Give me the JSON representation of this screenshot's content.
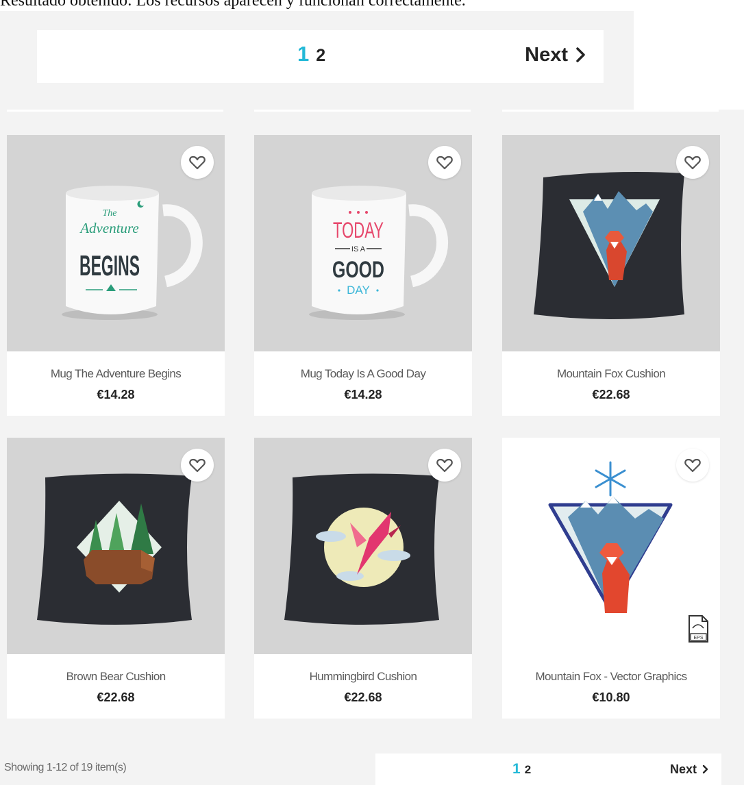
{
  "caption": "Resultado obtenido: Los recursos aparecen y funcionan correctamente.",
  "pagination": {
    "current_page": "1",
    "other_page": "2",
    "next_label": "Next"
  },
  "products": [
    {
      "name": "Mug The Adventure Begins",
      "price": "€14.28",
      "art": {
        "line1": "The",
        "line2": "Adventure",
        "line3": "BEGINS"
      }
    },
    {
      "name": "Mug Today Is A Good Day",
      "price": "€14.28",
      "art": {
        "line1": "TODAY",
        "line2": "IS A",
        "line3": "GOOD",
        "line4": "DAY"
      }
    },
    {
      "name": "Mountain Fox Cushion",
      "price": "€22.68"
    },
    {
      "name": "Brown Bear Cushion",
      "price": "€22.68"
    },
    {
      "name": "Hummingbird Cushion",
      "price": "€22.68"
    },
    {
      "name": "Mountain Fox - Vector Graphics",
      "price": "€10.80",
      "badge": "EPS"
    }
  ],
  "footer": {
    "count_text": "Showing 1-12 of 19 item(s)"
  },
  "icons": {
    "wishlist": "heart-outline-icon",
    "next": "chevron-right-icon",
    "file": "eps-file-icon"
  },
  "colors": {
    "accent": "#24b9d7",
    "background": "#f3f3f3",
    "image_bg": "#d4d4d4"
  }
}
